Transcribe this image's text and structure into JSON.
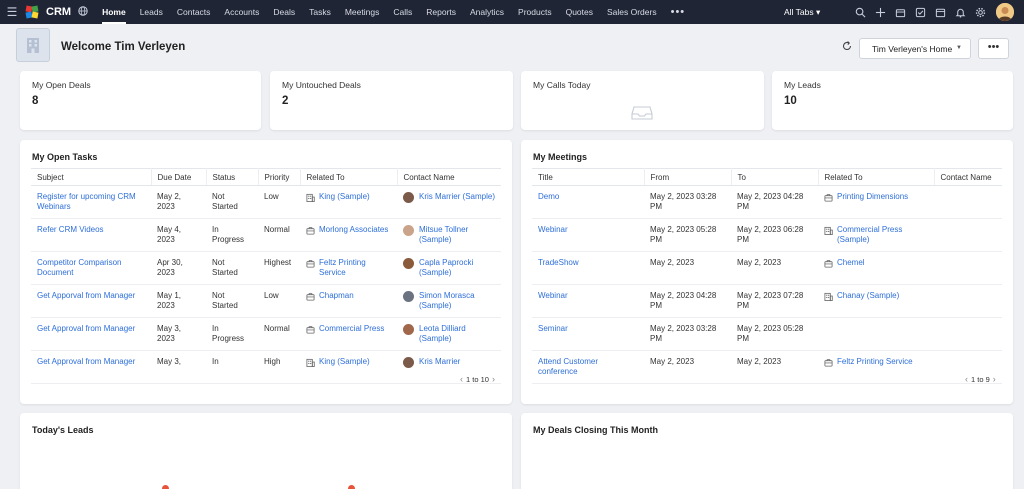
{
  "topbar": {
    "brand": "CRM",
    "nav": [
      "Home",
      "Leads",
      "Contacts",
      "Accounts",
      "Deals",
      "Tasks",
      "Meetings",
      "Calls",
      "Reports",
      "Analytics",
      "Products",
      "Quotes",
      "Sales Orders"
    ],
    "more": "•••",
    "all_tabs": "All Tabs ▾",
    "icons": [
      "search-icon",
      "plus-icon",
      "marketplace-icon",
      "tasks-check-icon",
      "calendar-icon",
      "bell-icon",
      "gear-icon",
      "user-avatar"
    ]
  },
  "header": {
    "welcome": "Welcome Tim Verleyen",
    "home_select": "Tim Verleyen's Home",
    "more_button": "•••"
  },
  "kpis": [
    {
      "title": "My Open Deals",
      "value": "8"
    },
    {
      "title": "My Untouched Deals",
      "value": "2"
    },
    {
      "title": "My Calls Today",
      "value": ""
    },
    {
      "title": "My Leads",
      "value": "10"
    }
  ],
  "open_tasks": {
    "title": "My Open Tasks",
    "columns": [
      "Subject",
      "Due Date",
      "Status",
      "Priority",
      "Related To",
      "Contact Name"
    ],
    "rows": [
      {
        "subject": "Register for upcoming CRM Webinars",
        "due": "May 2, 2023",
        "status": "Not Started",
        "priority": "Low",
        "related": "King (Sample)",
        "related_type": "building",
        "contact": "Kris Marrier (Sample)"
      },
      {
        "subject": "Refer CRM Videos",
        "due": "May 4, 2023",
        "status": "In Progress",
        "priority": "Normal",
        "related": "Morlong Associates",
        "related_type": "deal",
        "contact": "Mitsue Tollner (Sample)"
      },
      {
        "subject": "Competitor Comparison Document",
        "due": "Apr 30, 2023",
        "status": "Not Started",
        "priority": "Highest",
        "related": "Feltz Printing Service",
        "related_type": "deal",
        "contact": "Capla Paprocki (Sample)"
      },
      {
        "subject": "Get Apporval from Manager",
        "due": "May 1, 2023",
        "status": "Not Started",
        "priority": "Low",
        "related": "Chapman",
        "related_type": "deal",
        "contact": "Simon Morasca (Sample)"
      },
      {
        "subject": "Get Approval from Manager",
        "due": "May 3, 2023",
        "status": "In Progress",
        "priority": "Normal",
        "related": "Commercial Press",
        "related_type": "deal",
        "contact": "Leota Dilliard (Sample)"
      },
      {
        "subject": "Get Approval from Manager",
        "due": "May 3,",
        "status": "In",
        "priority": "High",
        "related": "King (Sample)",
        "related_type": "building",
        "contact": "Kris Marrier"
      }
    ],
    "pager": "1 to 10"
  },
  "meetings": {
    "title": "My Meetings",
    "columns": [
      "Title",
      "From",
      "To",
      "Related To",
      "Contact Name"
    ],
    "rows": [
      {
        "title": "Demo",
        "from": "May 2, 2023 03:28 PM",
        "to": "May 2, 2023 04:28 PM",
        "related": "Printing Dimensions",
        "related_type": "deal"
      },
      {
        "title": "Webinar",
        "from": "May 2, 2023 05:28 PM",
        "to": "May 2, 2023 06:28 PM",
        "related": "Commercial Press (Sample)",
        "related_type": "building"
      },
      {
        "title": "TradeShow",
        "from": "May 2, 2023",
        "to": "May 2, 2023",
        "related": "Chemel",
        "related_type": "deal"
      },
      {
        "title": "Webinar",
        "from": "May 2, 2023 04:28 PM",
        "to": "May 2, 2023 07:28 PM",
        "related": "Chanay (Sample)",
        "related_type": "building"
      },
      {
        "title": "Seminar",
        "from": "May 2, 2023 03:28 PM",
        "to": "May 2, 2023 05:28 PM",
        "related": "",
        "related_type": ""
      },
      {
        "title": "Attend Customer conference",
        "from": "May 2, 2023",
        "to": "May 2, 2023",
        "related": "Feltz Printing Service",
        "related_type": "deal"
      }
    ],
    "pager": "1 to 9"
  },
  "bottom": {
    "todays_leads": "Today's Leads",
    "deals_closing": "My Deals Closing This Month"
  },
  "colors": {
    "topbar": "#1f2535",
    "link": "#2e6fd9",
    "background": "#eef0f4"
  }
}
